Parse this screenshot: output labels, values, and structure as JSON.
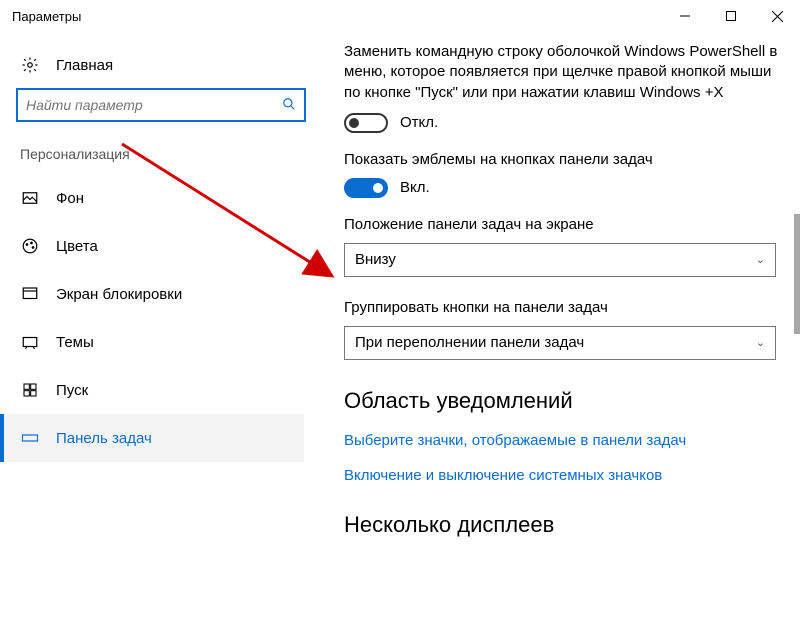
{
  "window": {
    "title": "Параметры"
  },
  "sidebar": {
    "home": "Главная",
    "search_placeholder": "Найти параметр",
    "section": "Персонализация",
    "items": [
      {
        "label": "Фон"
      },
      {
        "label": "Цвета"
      },
      {
        "label": "Экран блокировки"
      },
      {
        "label": "Темы"
      },
      {
        "label": "Пуск"
      },
      {
        "label": "Панель задач"
      }
    ]
  },
  "content": {
    "powershell_desc": "Заменить командную строку оболочкой Windows PowerShell в меню, которое появляется при щелчке правой кнопкой мыши по кнопке \"Пуск\" или при нажатии клавиш Windows +X",
    "toggle_off": "Откл.",
    "badges_label": "Показать эмблемы на кнопках панели задач",
    "toggle_on": "Вкл.",
    "position_label": "Положение панели задач на экране",
    "position_value": "Внизу",
    "group_label": "Группировать кнопки на панели задач",
    "group_value": "При переполнении панели задач",
    "notif_heading": "Область уведомлений",
    "link_icons": "Выберите значки, отображаемые в панели задач",
    "link_system": "Включение и выключение системных значков",
    "multi_heading": "Несколько дисплеев"
  }
}
